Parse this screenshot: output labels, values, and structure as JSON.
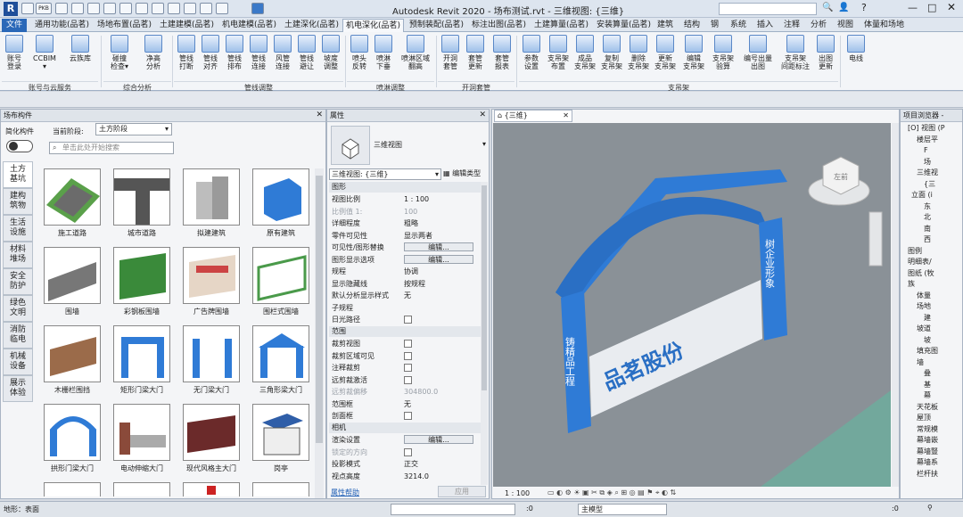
{
  "app": {
    "title": "Autodesk Revit 2020 - 场布测试.rvt - 三维视图: {三维}"
  },
  "quickaccess": {
    "logo": "R",
    "pkg": "PKB"
  },
  "tabs": [
    {
      "label": "文件"
    },
    {
      "label": "通用功能(品茗)"
    },
    {
      "label": "场地布置(品茗)"
    },
    {
      "label": "土建建模(品茗)"
    },
    {
      "label": "机电建模(品茗)"
    },
    {
      "label": "土建深化(品茗)"
    },
    {
      "label": "机电深化(品茗)"
    },
    {
      "label": "预制装配(品茗)"
    },
    {
      "label": "标注出图(品茗)"
    },
    {
      "label": "土建算量(品茗)"
    },
    {
      "label": "安装算量(品茗)"
    },
    {
      "label": "建筑"
    },
    {
      "label": "结构"
    },
    {
      "label": "钢"
    },
    {
      "label": "系统"
    },
    {
      "label": "插入"
    },
    {
      "label": "注释"
    },
    {
      "label": "分析"
    },
    {
      "label": "视图"
    },
    {
      "label": "体量和场地"
    }
  ],
  "ribbon": {
    "buttons": [
      {
        "label": "账号\n登录"
      },
      {
        "label": "CCBIM\n▾"
      },
      {
        "label": "云族库"
      },
      {
        "label": "碰撞\n检查▾"
      },
      {
        "label": "净高\n分析"
      },
      {
        "label": "管线\n打断"
      },
      {
        "label": "管线\n对齐"
      },
      {
        "label": "管线\n排布"
      },
      {
        "label": "管线\n连接"
      },
      {
        "label": "风管\n连接"
      },
      {
        "label": "管线\n避让"
      },
      {
        "label": "坡度\n调整"
      },
      {
        "label": "喷头\n反转"
      },
      {
        "label": "喷淋\n下垂"
      },
      {
        "label": "喷淋区域\n翻高"
      },
      {
        "label": "开洞\n套管"
      },
      {
        "label": "套管\n更新"
      },
      {
        "label": "套管\n报表"
      },
      {
        "label": "参数\n设置"
      },
      {
        "label": "支吊架\n布置"
      },
      {
        "label": "成品\n支吊架"
      },
      {
        "label": "复制\n支吊架"
      },
      {
        "label": "删除\n支吊架"
      },
      {
        "label": "更新\n支吊架"
      },
      {
        "label": "编辑\n支吊架"
      },
      {
        "label": "支吊架\n验算"
      },
      {
        "label": "编号出量\n出图"
      },
      {
        "label": "支吊架\n间距标注"
      },
      {
        "label": "出图\n更新"
      },
      {
        "label": "电线"
      }
    ],
    "groups": [
      {
        "label": "账号与云服务"
      },
      {
        "label": "综合分析"
      },
      {
        "label": "管线调整"
      },
      {
        "label": "喷淋调整"
      },
      {
        "label": "开洞套管"
      },
      {
        "label": "支吊架"
      }
    ]
  },
  "library": {
    "title": "场布构件",
    "toggle_label": "简化构件",
    "phase_label": "当前阶段:",
    "phase_value": "土方阶段",
    "search_placeholder": "单击此处开始搜索",
    "categories": [
      {
        "label": "土方\n基坑"
      },
      {
        "label": "建构\n筑物"
      },
      {
        "label": "生活\n设施"
      },
      {
        "label": "材料\n堆场"
      },
      {
        "label": "安全\n防护"
      },
      {
        "label": "绿色\n文明"
      },
      {
        "label": "消防\n临电"
      },
      {
        "label": "机械\n设备"
      },
      {
        "label": "展示\n体验"
      }
    ],
    "items": [
      {
        "label": "施工道路"
      },
      {
        "label": "城市道路"
      },
      {
        "label": "拟建建筑"
      },
      {
        "label": "原有建筑"
      },
      {
        "label": "围墙"
      },
      {
        "label": "彩钢板围墙"
      },
      {
        "label": "广告牌围墙"
      },
      {
        "label": "围栏式围墙"
      },
      {
        "label": "木栅栏围挡"
      },
      {
        "label": "矩形门梁大门"
      },
      {
        "label": "无门梁大门"
      },
      {
        "label": "三角形梁大门"
      },
      {
        "label": "拱形门梁大门"
      },
      {
        "label": "电动伸缩大门"
      },
      {
        "label": "现代风格主大门"
      },
      {
        "label": "岗亭"
      }
    ]
  },
  "properties": {
    "title": "属性",
    "type_name": "三维视图",
    "selector": "三维视图: {三维}",
    "edit_type": "编辑类型",
    "sections": {
      "graphics": "图形",
      "extents": "范围",
      "camera": "相机"
    },
    "graphics_rows": [
      {
        "k": "视图比例",
        "v": "1 : 100"
      },
      {
        "k": "比例值 1:",
        "v": "100",
        "dis": true
      },
      {
        "k": "详细程度",
        "v": "粗略"
      },
      {
        "k": "零件可见性",
        "v": "显示两者"
      },
      {
        "k": "可见性/图形替换",
        "btn": "编辑..."
      },
      {
        "k": "图形显示选项",
        "btn": "编辑..."
      },
      {
        "k": "规程",
        "v": "协调"
      },
      {
        "k": "显示隐藏线",
        "v": "按规程"
      },
      {
        "k": "默认分析显示样式",
        "v": "无"
      },
      {
        "k": "子规程",
        "v": ""
      },
      {
        "k": "日光路径",
        "cb": true
      }
    ],
    "extent_rows": [
      {
        "k": "裁剪视图",
        "cb": true
      },
      {
        "k": "裁剪区域可见",
        "cb": true
      },
      {
        "k": "注释裁剪",
        "cb": true
      },
      {
        "k": "远剪裁激活",
        "cb": true
      },
      {
        "k": "远剪裁偏移",
        "v": "304800.0",
        "dis": true
      },
      {
        "k": "范围框",
        "v": "无"
      },
      {
        "k": "剖面框",
        "cb": true
      }
    ],
    "camera_rows": [
      {
        "k": "渲染设置",
        "btn": "编辑..."
      },
      {
        "k": "锁定的方向",
        "cb": true,
        "dis": true
      },
      {
        "k": "投影模式",
        "v": "正交"
      },
      {
        "k": "视点高度",
        "v": "3214.0"
      }
    ],
    "help": "属性帮助",
    "apply": "应用"
  },
  "view": {
    "tab": "{三维}",
    "scale": "1 : 100",
    "cube_label": "左前",
    "sign_top": "品茗股份",
    "sign_left": "铸精品工程",
    "sign_right": "树企业形象",
    "colors": {
      "arch": "#2f7bd6",
      "wall": "#e9ecf0",
      "bg": "#8a9197",
      "ground": "#72a89c"
    }
  },
  "browser": {
    "title": "项目浏览器 -",
    "items": [
      {
        "label": "[O] 视图 (P"
      },
      {
        "label": "楼层平"
      },
      {
        "label": "F"
      },
      {
        "label": "场"
      },
      {
        "label": "三维视"
      },
      {
        "label": "{三"
      },
      {
        "label": "立面 (i"
      },
      {
        "label": "东"
      },
      {
        "label": "北"
      },
      {
        "label": "南"
      },
      {
        "label": "西"
      },
      {
        "label": "图例"
      },
      {
        "label": "明细表/"
      },
      {
        "label": "图纸 (牧"
      },
      {
        "label": "族"
      },
      {
        "label": "体量"
      },
      {
        "label": "场地"
      },
      {
        "label": "建"
      },
      {
        "label": "坡道"
      },
      {
        "label": "坡"
      },
      {
        "label": "填充图"
      },
      {
        "label": "墙"
      },
      {
        "label": "叠"
      },
      {
        "label": "基"
      },
      {
        "label": "幕"
      },
      {
        "label": "天花板"
      },
      {
        "label": "屋顶"
      },
      {
        "label": "常规模"
      },
      {
        "label": "幕墙嵌"
      },
      {
        "label": "幕墙豎"
      },
      {
        "label": "幕墙系"
      },
      {
        "label": "栏杆扶"
      }
    ]
  },
  "status": {
    "left": "地形：表面",
    "coord": ":0",
    "model": "主模型",
    "zero": ":0"
  }
}
